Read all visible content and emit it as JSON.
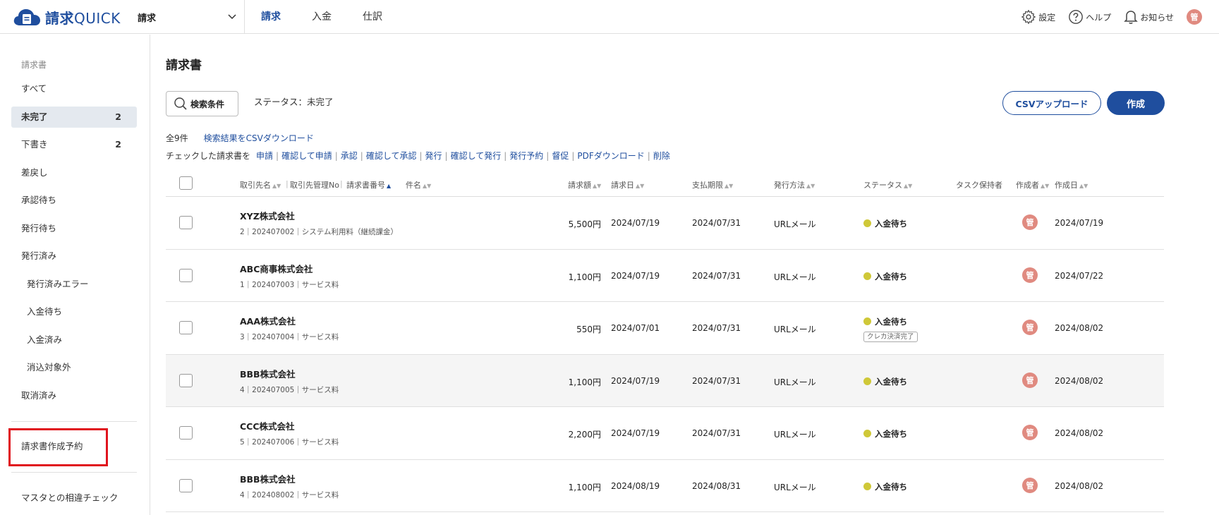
{
  "header": {
    "logo_main": "請求",
    "logo_sub": "QUICK",
    "product": "請求",
    "tabs": [
      {
        "label": "請求"
      },
      {
        "label": "入金"
      },
      {
        "label": "仕訳"
      }
    ],
    "settings": "設定",
    "help": "ヘルプ",
    "notifications": "お知らせ",
    "user_initial": "管"
  },
  "sidebar": {
    "heading": "請求書",
    "items": [
      {
        "label": "すべて",
        "count": ""
      },
      {
        "label": "未完了",
        "count": "2"
      },
      {
        "label": "下書き",
        "count": "2"
      },
      {
        "label": "差戻し",
        "count": ""
      },
      {
        "label": "承認待ち",
        "count": ""
      },
      {
        "label": "発行待ち",
        "count": ""
      },
      {
        "label": "発行済み",
        "count": ""
      },
      {
        "label": "発行済みエラー",
        "count": ""
      },
      {
        "label": "入金待ち",
        "count": ""
      },
      {
        "label": "入金済み",
        "count": ""
      },
      {
        "label": "消込対象外",
        "count": ""
      },
      {
        "label": "取消済み",
        "count": ""
      }
    ],
    "schedule": "請求書作成予約",
    "check": "マスタとの相違チェック"
  },
  "main": {
    "title": "請求書",
    "search_label": "検索条件",
    "status_filter": "ステータス：未完了",
    "csv_upload": "CSVアップロード",
    "create": "作成",
    "count": "全9件",
    "csv_download": "検索結果をCSVダウンロード",
    "actions_prefix": "チェックした請求書を",
    "actions": [
      "申請",
      "確認して申請",
      "承認",
      "確認して承認",
      "発行",
      "確認して発行",
      "発行予約",
      "督促",
      "PDFダウンロード",
      "削除"
    ]
  },
  "table": {
    "columns": {
      "client": "取引先名",
      "client_no": "取引先管理No",
      "invoice_no": "請求書番号",
      "subject": "件名",
      "amount": "請求額",
      "bill_date": "請求日",
      "due_date": "支払期限",
      "method": "発行方法",
      "status": "ステータス",
      "task_owner": "タスク保持者",
      "creator": "作成者",
      "created": "作成日"
    },
    "rows": [
      {
        "client": "XYZ株式会社",
        "meta": "2｜202407002｜システム利用料（継続課金）",
        "amount": "5,500円",
        "bill_date": "2024/07/19",
        "due_date": "2024/07/31",
        "method": "URLメール",
        "status": "入金待ち",
        "badge": "",
        "creator": "管",
        "created": "2024/07/19"
      },
      {
        "client": "ABC商事株式会社",
        "meta": "1｜202407003｜サービス料",
        "amount": "1,100円",
        "bill_date": "2024/07/19",
        "due_date": "2024/07/31",
        "method": "URLメール",
        "status": "入金待ち",
        "badge": "",
        "creator": "管",
        "created": "2024/07/22"
      },
      {
        "client": "AAA株式会社",
        "meta": "3｜202407004｜サービス料",
        "amount": "550円",
        "bill_date": "2024/07/01",
        "due_date": "2024/07/31",
        "method": "URLメール",
        "status": "入金待ち",
        "badge": "クレカ決済完了",
        "creator": "管",
        "created": "2024/08/02"
      },
      {
        "client": "BBB株式会社",
        "meta": "4｜202407005｜サービス料",
        "amount": "1,100円",
        "bill_date": "2024/07/19",
        "due_date": "2024/07/31",
        "method": "URLメール",
        "status": "入金待ち",
        "badge": "",
        "creator": "管",
        "created": "2024/08/02"
      },
      {
        "client": "CCC株式会社",
        "meta": "5｜202407006｜サービス料",
        "amount": "2,200円",
        "bill_date": "2024/07/19",
        "due_date": "2024/07/31",
        "method": "URLメール",
        "status": "入金待ち",
        "badge": "",
        "creator": "管",
        "created": "2024/08/02"
      },
      {
        "client": "BBB株式会社",
        "meta": "4｜202408002｜サービス料",
        "amount": "1,100円",
        "bill_date": "2024/08/19",
        "due_date": "2024/08/31",
        "method": "URLメール",
        "status": "入金待ち",
        "badge": "",
        "creator": "管",
        "created": "2024/08/02"
      }
    ]
  }
}
